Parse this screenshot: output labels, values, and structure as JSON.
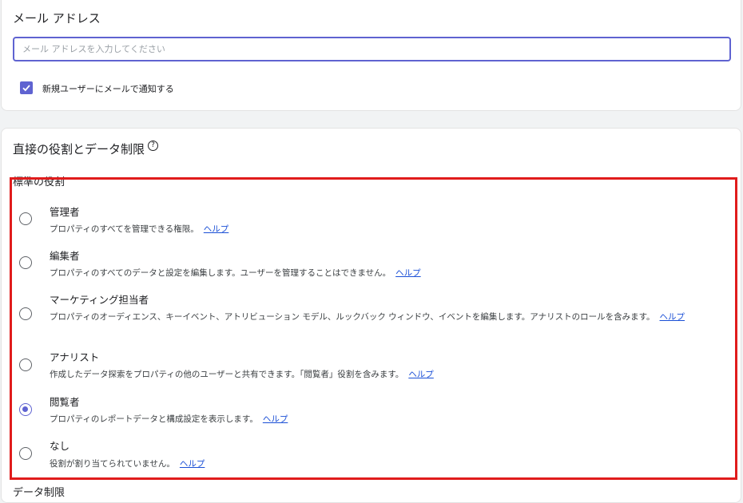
{
  "email_section": {
    "title": "メール アドレス",
    "input_placeholder": "メール アドレスを入力してください",
    "notify_label": "新規ユーザーにメールで通知する",
    "notify_checked": true
  },
  "roles_section": {
    "title": "直接の役割とデータ制限",
    "help_icon_glyph": "?",
    "standard_roles_label": "標準の役割",
    "data_limits_label": "データ制限",
    "help_link_text": "ヘルプ",
    "roles": [
      {
        "name": "管理者",
        "description": "プロパティのすべてを管理できる権限。",
        "selected": false
      },
      {
        "name": "編集者",
        "description": "プロパティのすべてのデータと設定を編集します。ユーザーを管理することはできません。",
        "selected": false
      },
      {
        "name": "マーケティング担当者",
        "description": "プロパティのオーディエンス、キーイベント、アトリビューション モデル、ルックバック ウィンドウ、イベントを編集します。アナリストのロールを含みます。",
        "selected": false
      },
      {
        "name": "アナリスト",
        "description": "作成したデータ探索をプロパティの他のユーザーと共有できます。「閲覧者」役割を含みます。",
        "selected": false
      },
      {
        "name": "閲覧者",
        "description": "プロパティのレポートデータと構成設定を表示します。",
        "selected": true
      },
      {
        "name": "なし",
        "description": "役割が割り当てられていません。",
        "selected": false
      }
    ]
  },
  "colors": {
    "accent": "#5f63d1",
    "highlight_border": "#e01c1c",
    "link": "#1a4fd6"
  }
}
